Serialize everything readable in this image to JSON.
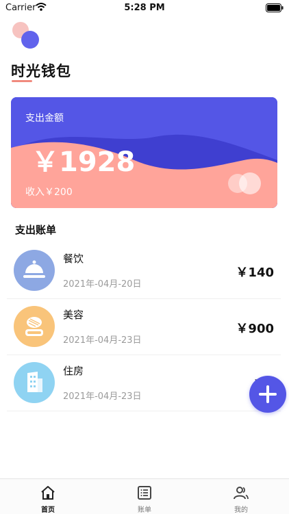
{
  "status_bar": {
    "carrier": "Carrier",
    "time": "5:28 PM"
  },
  "app": {
    "title": "时光钱包"
  },
  "summary": {
    "label": "支出金额",
    "amount": "￥1928",
    "income": "收入￥200"
  },
  "section": {
    "title": "支出账单"
  },
  "bills": [
    {
      "name": "餐饮",
      "date": "2021年-04月-20日",
      "amount": "￥140",
      "icon": "cloche-icon",
      "color": "#8da8e3"
    },
    {
      "name": "美容",
      "date": "2021年-04月-23日",
      "amount": "￥900",
      "icon": "cosmetic-compact-icon",
      "color": "#f9c47a"
    },
    {
      "name": "住房",
      "date": "2021年-04月-23日",
      "amount": "￥8",
      "icon": "building-icon",
      "color": "#8fd3f2"
    }
  ],
  "fab": {
    "icon": "plus-icon"
  },
  "tabs": [
    {
      "label": "首页",
      "icon": "home-icon",
      "active": true
    },
    {
      "label": "账单",
      "icon": "list-icon",
      "active": false
    },
    {
      "label": "我的",
      "icon": "users-icon",
      "active": false
    }
  ],
  "colors": {
    "accent": "#5456e6",
    "wave": "#ffa49a",
    "underline": "#f08a7e"
  }
}
